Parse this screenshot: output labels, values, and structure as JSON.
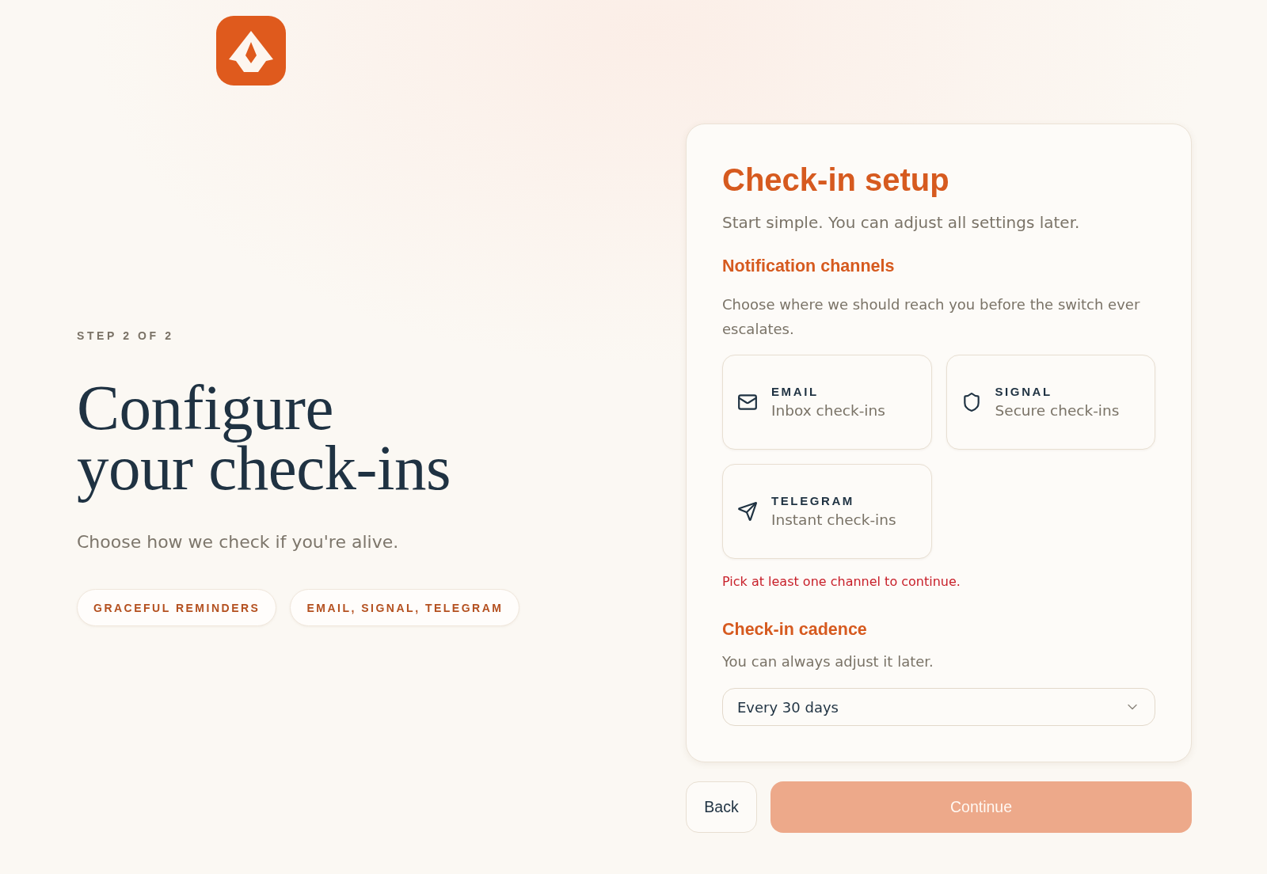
{
  "intro": {
    "step": "STEP 2 OF 2",
    "title_lines": [
      "Configure",
      "your check-ins"
    ],
    "subtitle": "Choose how we check if you're alive.",
    "tags": [
      "GRACEFUL REMINDERS",
      "EMAIL, SIGNAL, TELEGRAM"
    ]
  },
  "card": {
    "title": "Check-in setup",
    "subtitle": "Start simple. You can adjust all settings later.",
    "channels": {
      "heading": "Notification channels",
      "description": "Choose where we should reach you before the switch ever escalates.",
      "options": [
        {
          "kind": "email",
          "label": "EMAIL",
          "detail": "Inbox check-ins",
          "selected": false
        },
        {
          "kind": "signal",
          "label": "SIGNAL",
          "detail": "Secure check-ins",
          "selected": false
        },
        {
          "kind": "telegram",
          "label": "TELEGRAM",
          "detail": "Instant check-ins",
          "selected": false
        }
      ],
      "error": "Pick at least one channel to continue."
    },
    "cadence": {
      "heading": "Check-in cadence",
      "description": "You can always adjust it later.",
      "select": {
        "value": "Every 30 days"
      }
    }
  },
  "actions": [
    {
      "kind": "secondary",
      "label": "Back",
      "disabled": false
    },
    {
      "kind": "primary",
      "label": "Continue",
      "disabled": true
    }
  ]
}
